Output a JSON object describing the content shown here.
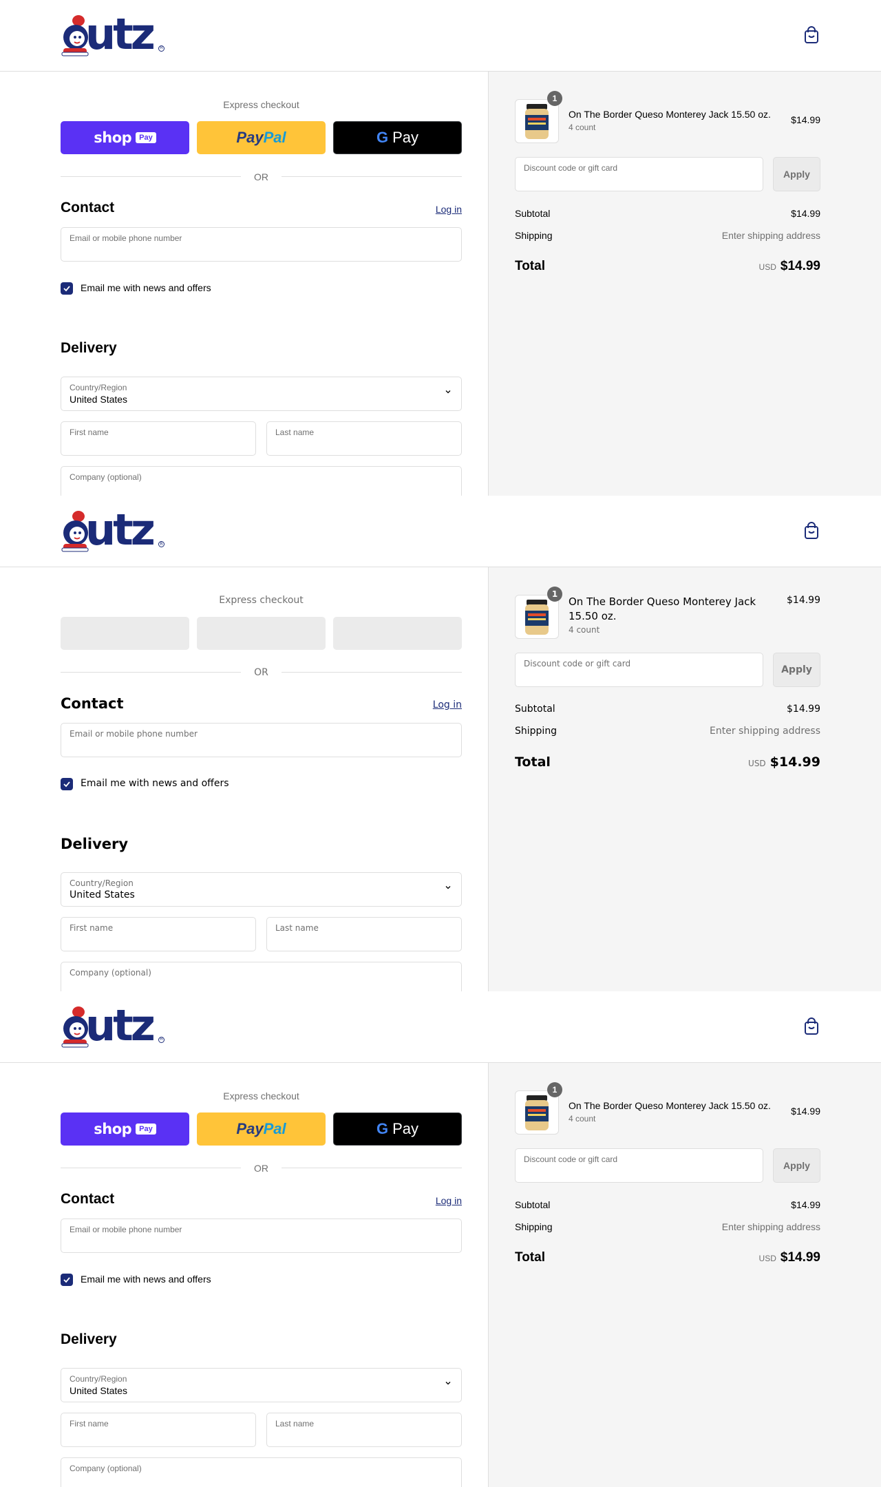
{
  "brand": {
    "name": "utz"
  },
  "express": {
    "title": "Express checkout",
    "or": "OR",
    "shop_label": "shop",
    "shop_pill": "Pay",
    "paypal_a": "Pay",
    "paypal_b": "Pal",
    "gpay_g": "G",
    "gpay_label": "Pay"
  },
  "contact": {
    "heading": "Contact",
    "login": "Log in",
    "email_placeholder": "Email or mobile phone number",
    "news_label": "Email me with news and offers",
    "news_checked": true
  },
  "delivery": {
    "heading": "Delivery",
    "country_label": "Country/Region",
    "country_value": "United States",
    "first_name": "First name",
    "last_name": "Last name",
    "company": "Company (optional)"
  },
  "cart": {
    "item": {
      "name": "On The Border Queso Monterey Jack 15.50 oz.",
      "variant": "4 count",
      "price": "$14.99",
      "quantity": "1"
    },
    "discount_placeholder": "Discount code or gift card",
    "apply": "Apply",
    "subtotal_label": "Subtotal",
    "subtotal": "$14.99",
    "shipping_label": "Shipping",
    "shipping": "Enter shipping address",
    "total_label": "Total",
    "currency": "USD",
    "total": "$14.99"
  }
}
